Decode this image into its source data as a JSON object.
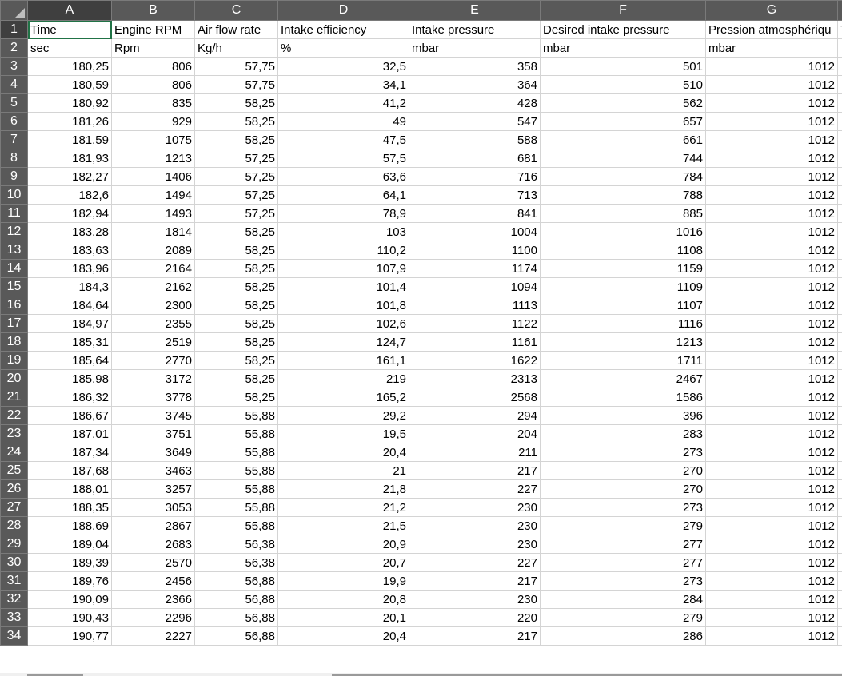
{
  "columns": [
    "A",
    "B",
    "C",
    "D",
    "E",
    "F",
    "G"
  ],
  "headers": [
    "Time",
    "Engine RPM",
    "Air flow rate",
    "Intake efficiency",
    "Intake pressure",
    "Desired intake pressure",
    "Pression atmosphériqu"
  ],
  "units": [
    "sec",
    "Rpm",
    "Kg/h",
    "%",
    "mbar",
    "mbar",
    "mbar"
  ],
  "overflow_text": "T",
  "rows": [
    [
      "180,25",
      "806",
      "57,75",
      "32,5",
      "358",
      "501",
      "1012"
    ],
    [
      "180,59",
      "806",
      "57,75",
      "34,1",
      "364",
      "510",
      "1012"
    ],
    [
      "180,92",
      "835",
      "58,25",
      "41,2",
      "428",
      "562",
      "1012"
    ],
    [
      "181,26",
      "929",
      "58,25",
      "49",
      "547",
      "657",
      "1012"
    ],
    [
      "181,59",
      "1075",
      "58,25",
      "47,5",
      "588",
      "661",
      "1012"
    ],
    [
      "181,93",
      "1213",
      "57,25",
      "57,5",
      "681",
      "744",
      "1012"
    ],
    [
      "182,27",
      "1406",
      "57,25",
      "63,6",
      "716",
      "784",
      "1012"
    ],
    [
      "182,6",
      "1494",
      "57,25",
      "64,1",
      "713",
      "788",
      "1012"
    ],
    [
      "182,94",
      "1493",
      "57,25",
      "78,9",
      "841",
      "885",
      "1012"
    ],
    [
      "183,28",
      "1814",
      "58,25",
      "103",
      "1004",
      "1016",
      "1012"
    ],
    [
      "183,63",
      "2089",
      "58,25",
      "110,2",
      "1100",
      "1108",
      "1012"
    ],
    [
      "183,96",
      "2164",
      "58,25",
      "107,9",
      "1174",
      "1159",
      "1012"
    ],
    [
      "184,3",
      "2162",
      "58,25",
      "101,4",
      "1094",
      "1109",
      "1012"
    ],
    [
      "184,64",
      "2300",
      "58,25",
      "101,8",
      "1113",
      "1107",
      "1012"
    ],
    [
      "184,97",
      "2355",
      "58,25",
      "102,6",
      "1122",
      "1116",
      "1012"
    ],
    [
      "185,31",
      "2519",
      "58,25",
      "124,7",
      "1161",
      "1213",
      "1012"
    ],
    [
      "185,64",
      "2770",
      "58,25",
      "161,1",
      "1622",
      "1711",
      "1012"
    ],
    [
      "185,98",
      "3172",
      "58,25",
      "219",
      "2313",
      "2467",
      "1012"
    ],
    [
      "186,32",
      "3778",
      "58,25",
      "165,2",
      "2568",
      "1586",
      "1012"
    ],
    [
      "186,67",
      "3745",
      "55,88",
      "29,2",
      "294",
      "396",
      "1012"
    ],
    [
      "187,01",
      "3751",
      "55,88",
      "19,5",
      "204",
      "283",
      "1012"
    ],
    [
      "187,34",
      "3649",
      "55,88",
      "20,4",
      "211",
      "273",
      "1012"
    ],
    [
      "187,68",
      "3463",
      "55,88",
      "21",
      "217",
      "270",
      "1012"
    ],
    [
      "188,01",
      "3257",
      "55,88",
      "21,8",
      "227",
      "270",
      "1012"
    ],
    [
      "188,35",
      "3053",
      "55,88",
      "21,2",
      "230",
      "273",
      "1012"
    ],
    [
      "188,69",
      "2867",
      "55,88",
      "21,5",
      "230",
      "279",
      "1012"
    ],
    [
      "189,04",
      "2683",
      "56,38",
      "20,9",
      "230",
      "277",
      "1012"
    ],
    [
      "189,39",
      "2570",
      "56,38",
      "20,7",
      "227",
      "277",
      "1012"
    ],
    [
      "189,76",
      "2456",
      "56,88",
      "19,9",
      "217",
      "273",
      "1012"
    ],
    [
      "190,09",
      "2366",
      "56,88",
      "20,8",
      "230",
      "284",
      "1012"
    ],
    [
      "190,43",
      "2296",
      "56,88",
      "20,1",
      "220",
      "279",
      "1012"
    ],
    [
      "190,77",
      "2227",
      "56,88",
      "20,4",
      "217",
      "286",
      "1012"
    ]
  ],
  "row_numbers": [
    "1",
    "2",
    "3",
    "4",
    "5",
    "6",
    "7",
    "8",
    "9",
    "10",
    "11",
    "12",
    "13",
    "14",
    "15",
    "16",
    "17",
    "18",
    "19",
    "20",
    "21",
    "22",
    "23",
    "24",
    "25",
    "26",
    "27",
    "28",
    "29",
    "30",
    "31",
    "32",
    "33",
    "34"
  ]
}
